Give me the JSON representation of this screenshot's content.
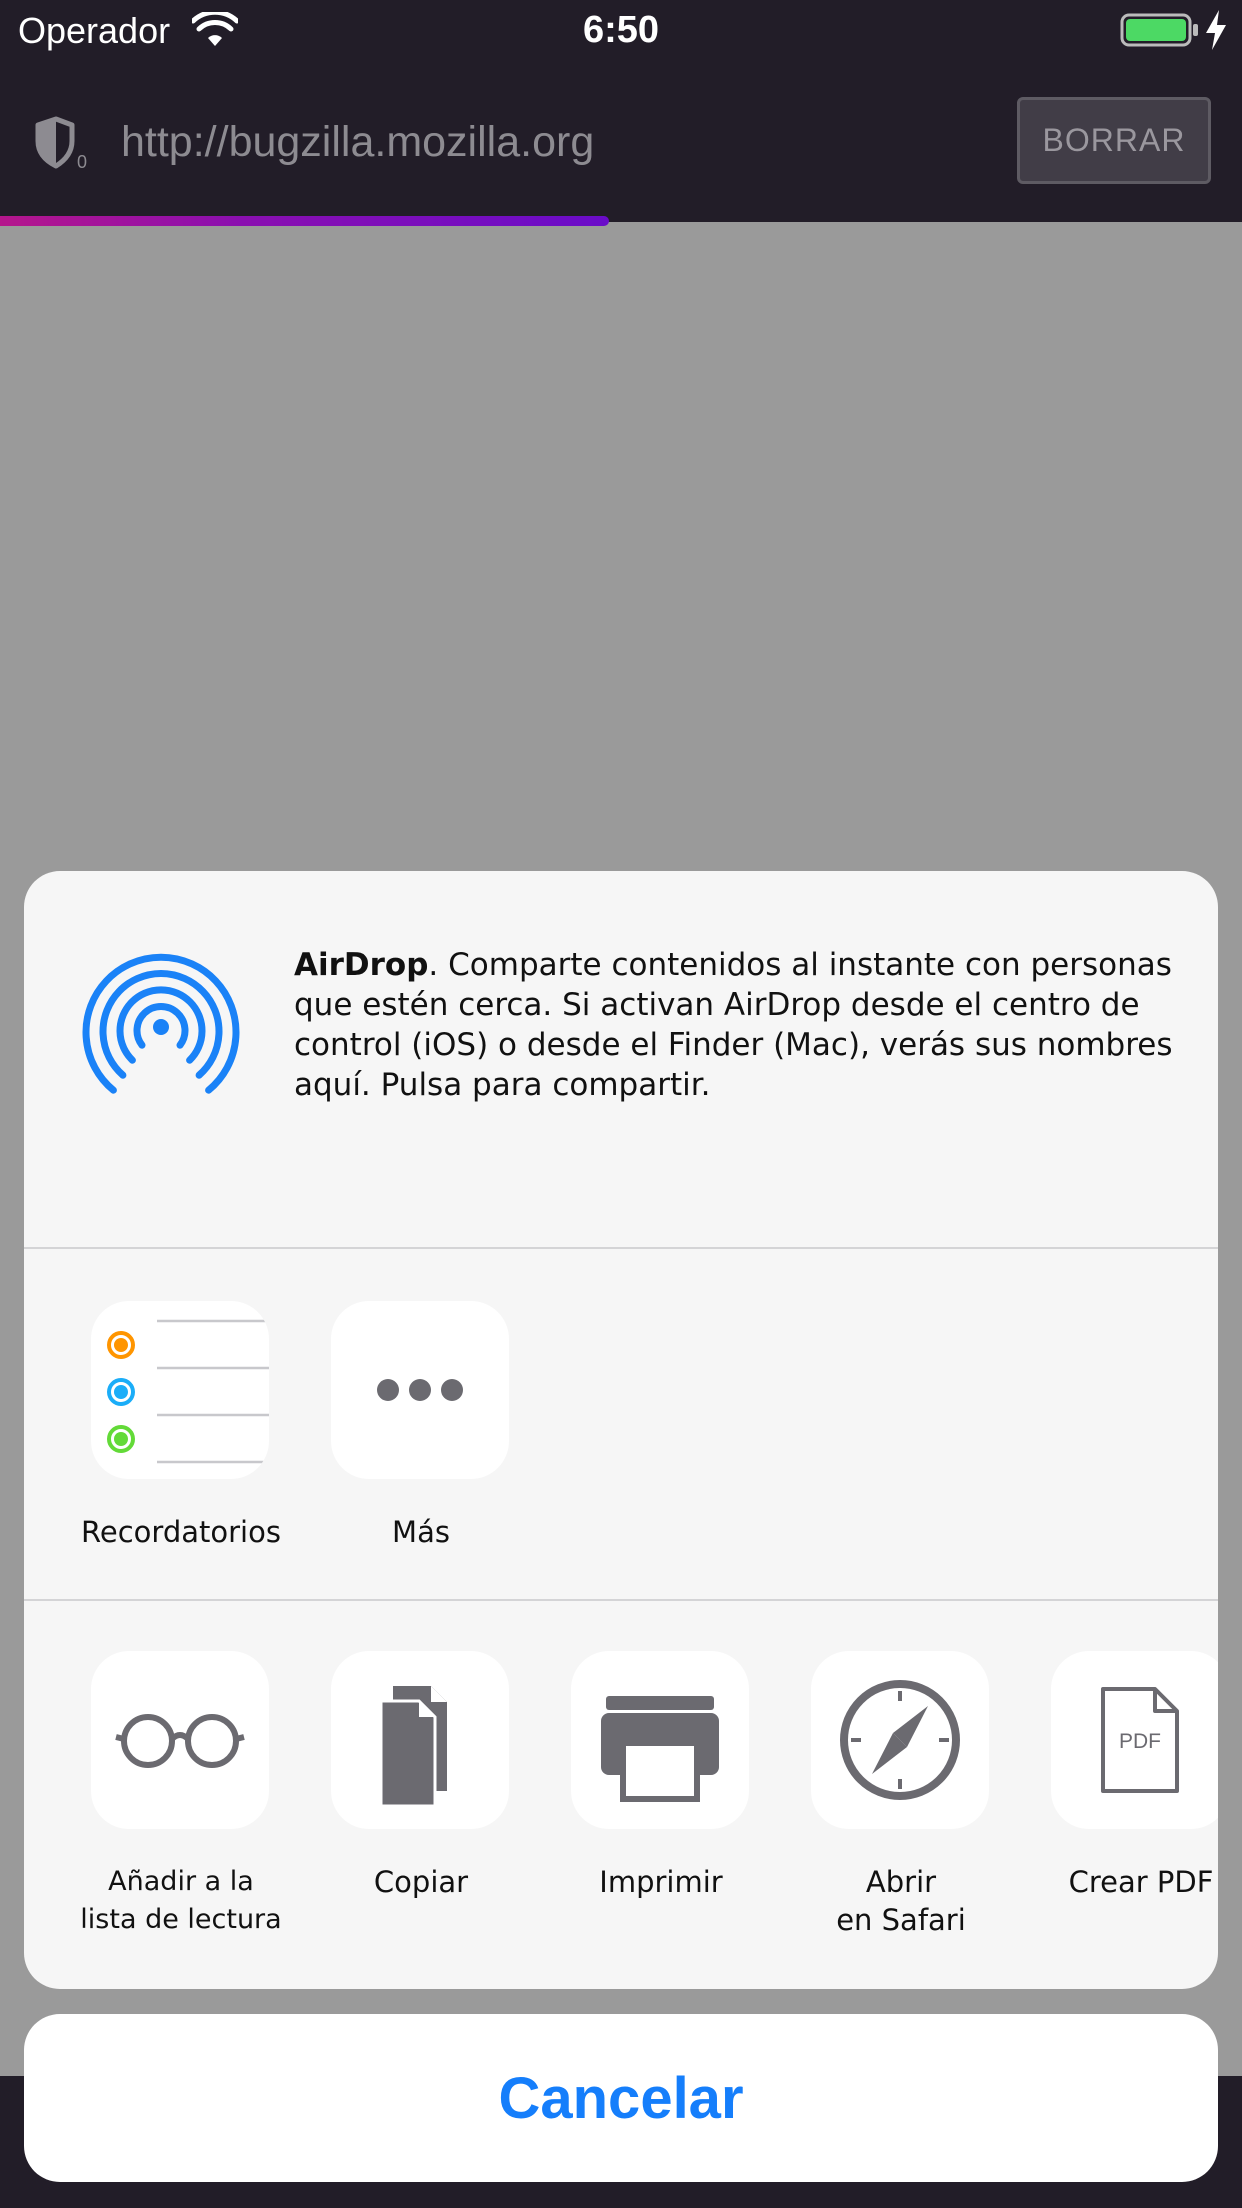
{
  "status_bar": {
    "carrier": "Operador",
    "time": "6:50"
  },
  "browser": {
    "tracker_count": "0",
    "url": "http://bugzilla.mozilla.org",
    "erase_label": "BORRAR",
    "load_progress": 0.49
  },
  "share_sheet": {
    "airdrop": {
      "title": "AirDrop",
      "description": ". Comparte contenidos al instante con personas que estén cerca. Si activan AirDrop desde el centro de control (iOS) o desde el Finder (Mac), verás sus nombres aquí. Pulsa para compartir."
    },
    "apps": [
      {
        "label": "Recordatorios",
        "icon": "reminders-icon"
      },
      {
        "label": "Más",
        "icon": "more-icon"
      }
    ],
    "actions": [
      {
        "label": "Añadir a la\nlista de lectura",
        "icon": "glasses-icon"
      },
      {
        "label": "Copiar",
        "icon": "copy-icon"
      },
      {
        "label": "Imprimir",
        "icon": "printer-icon"
      },
      {
        "label": "Abrir\nen Safari",
        "icon": "compass-icon"
      },
      {
        "label": "Crear PDF",
        "icon": "pdf-icon",
        "icon_text": "PDF"
      }
    ],
    "cancel_label": "Cancelar"
  },
  "colors": {
    "accent": "#157efb",
    "toolbar": "#221d28",
    "dim_overlay": "#9a9a9a"
  }
}
